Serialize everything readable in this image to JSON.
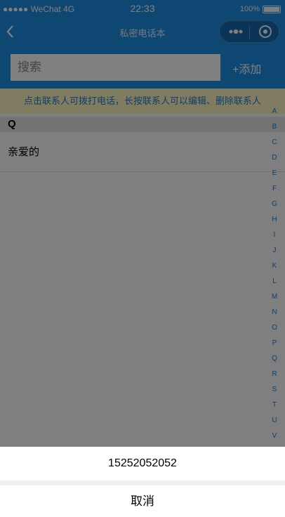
{
  "statusbar": {
    "carrier": "●●●●● WeChat 4G",
    "time": "22:33",
    "battery": "100%"
  },
  "navbar": {
    "title": "私密电话本"
  },
  "search": {
    "placeholder": "搜索",
    "add_label": "+添加"
  },
  "hint": "点击联系人可拨打电话，长按联系人可以编辑、删除联系人",
  "contacts": {
    "section": "Q",
    "items": [
      {
        "name": "亲爱的"
      }
    ]
  },
  "index_letters": [
    "A",
    "B",
    "C",
    "D",
    "E",
    "F",
    "G",
    "H",
    "I",
    "J",
    "K",
    "L",
    "M",
    "N",
    "O",
    "P",
    "Q",
    "R",
    "S",
    "T",
    "U",
    "V"
  ],
  "actionsheet": {
    "phone": "15252052052",
    "cancel": "取消"
  },
  "colors": {
    "primary": "#1e8ee6",
    "hint_bg": "#fff8c5",
    "hint_text": "#1e7fd0"
  }
}
